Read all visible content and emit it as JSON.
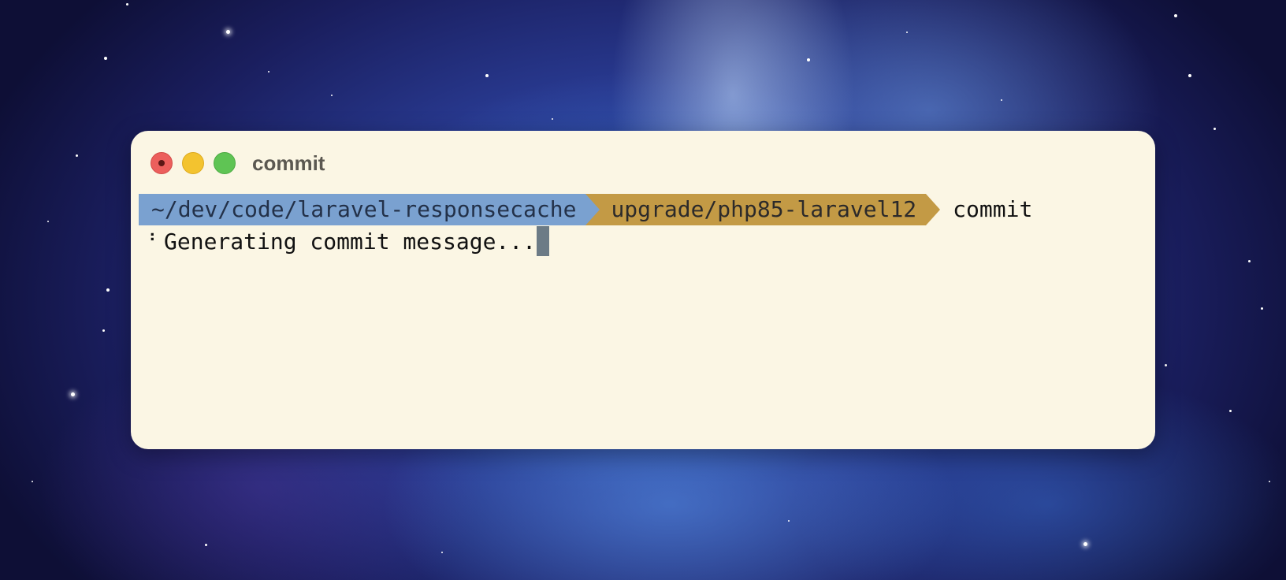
{
  "window": {
    "title": "commit"
  },
  "prompt": {
    "path": "~/dev/code/laravel-responsecache",
    "branch": "upgrade/php85-laravel12",
    "command": "commit"
  },
  "output": {
    "spinner": "⠘",
    "message": "Generating commit message..."
  },
  "colors": {
    "terminal_bg": "#fbf6e4",
    "path_segment": "#7aa1d0",
    "branch_segment": "#c39a45",
    "cursor": "#6c7b86",
    "close": "#ec5f5c",
    "minimize": "#f3c32f",
    "maximize": "#5fc454"
  }
}
